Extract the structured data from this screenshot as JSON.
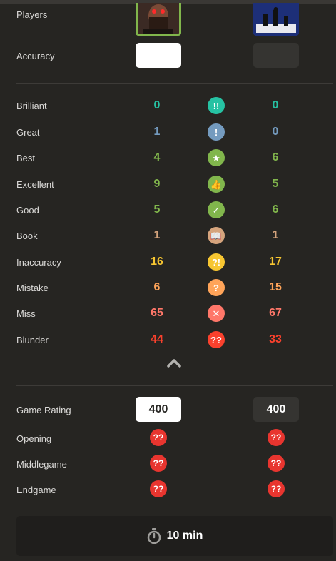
{
  "colors": {
    "background": "#262522",
    "brilliant": "#26c2a3",
    "great": "#749bbf",
    "best": "#81b64c",
    "excellent": "#81b64c",
    "good": "#81b64c",
    "book": "#d5a47d",
    "inaccuracy": "#f7c631",
    "mistake": "#ffa459",
    "miss": "#ff7769",
    "blunder": "#fa412d"
  },
  "players": {
    "label": "Players",
    "white_avatar_icon": "player-avatar",
    "black_avatar_icon": "chess-pieces-avatar"
  },
  "accuracy": {
    "label": "Accuracy",
    "white": "",
    "black": ""
  },
  "classifications": [
    {
      "label": "Brilliant",
      "icon": "brilliant-icon",
      "glyph": "!!",
      "white": "0",
      "black": "0"
    },
    {
      "label": "Great",
      "icon": "great-icon",
      "glyph": "!",
      "white": "1",
      "black": "0"
    },
    {
      "label": "Best",
      "icon": "best-icon",
      "glyph": "★",
      "white": "4",
      "black": "6"
    },
    {
      "label": "Excellent",
      "icon": "thumbs-up-icon",
      "glyph": "👍",
      "white": "9",
      "black": "5"
    },
    {
      "label": "Good",
      "icon": "checkmark-icon",
      "glyph": "✓",
      "white": "5",
      "black": "6"
    },
    {
      "label": "Book",
      "icon": "book-icon",
      "glyph": "📖",
      "white": "1",
      "black": "1"
    },
    {
      "label": "Inaccuracy",
      "icon": "inaccuracy-icon",
      "glyph": "?!",
      "white": "16",
      "black": "17"
    },
    {
      "label": "Mistake",
      "icon": "mistake-icon",
      "glyph": "?",
      "white": "6",
      "black": "15"
    },
    {
      "label": "Miss",
      "icon": "miss-icon",
      "glyph": "✕",
      "white": "65",
      "black": "67"
    },
    {
      "label": "Blunder",
      "icon": "blunder-icon",
      "glyph": "??",
      "white": "44",
      "black": "33"
    }
  ],
  "game_rating": {
    "label": "Game Rating",
    "white": "400",
    "black": "400"
  },
  "phases": [
    {
      "label": "Opening",
      "glyph": "??"
    },
    {
      "label": "Middlegame",
      "glyph": "??"
    },
    {
      "label": "Endgame",
      "glyph": "??"
    }
  ],
  "time_control": {
    "icon": "stopwatch-icon",
    "label": "10 min"
  }
}
